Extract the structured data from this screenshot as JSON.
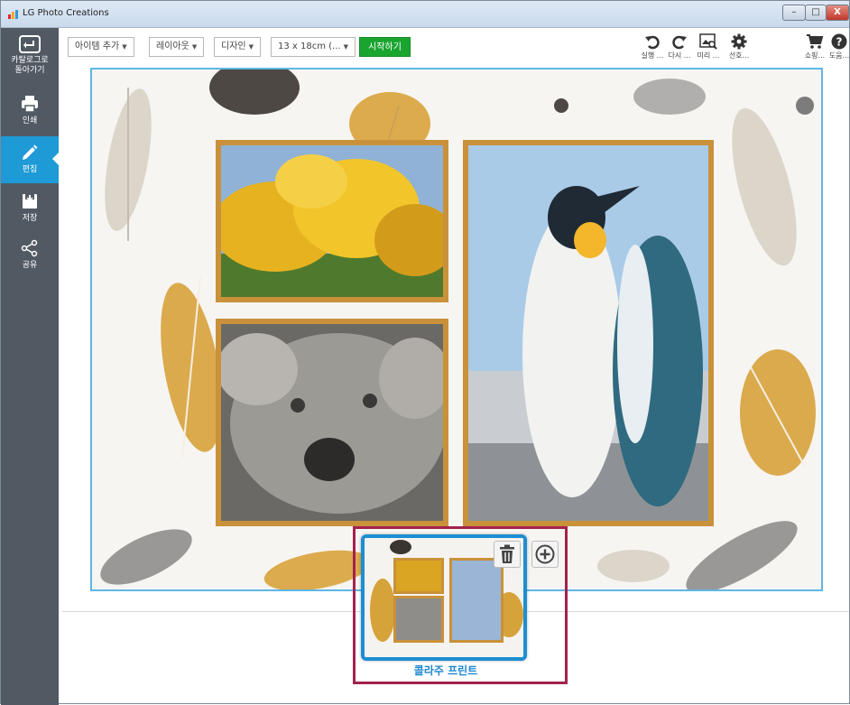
{
  "window": {
    "title": "LG Photo Creations",
    "controls": [
      "–",
      "□",
      "X"
    ]
  },
  "sidebar": {
    "items": [
      {
        "label": "카탈로그로 돌아가기",
        "icon": "back-arrow-icon"
      },
      {
        "label": "인쇄",
        "icon": "printer-icon"
      },
      {
        "label": "편집",
        "icon": "pencil-icon"
      },
      {
        "label": "저장",
        "icon": "save-icon"
      },
      {
        "label": "공유",
        "icon": "share-icon"
      }
    ],
    "active": "편집"
  },
  "toolbar": {
    "add_item": "아이템 추가",
    "layout": "레이아웃",
    "design": "디자인",
    "size": "13 x 18cm (...",
    "start": "시작하기",
    "undo": "실행 ...",
    "redo": "다시 ...",
    "preview": "미리 ...",
    "preferences": "선호...",
    "shop": "쇼핑...",
    "help": "도움..."
  },
  "page_thumbnail": {
    "label": "콜라주 프린트",
    "delete_icon": "trash-icon",
    "add_icon": "plus-circle-icon"
  },
  "colors": {
    "sidebar": "#515a63",
    "active": "#1e9ad6",
    "start_button": "#1aa531",
    "frame": "#c9913a",
    "canvas_border": "#5fb7e6",
    "thumb_highlight": "#a3224e"
  }
}
